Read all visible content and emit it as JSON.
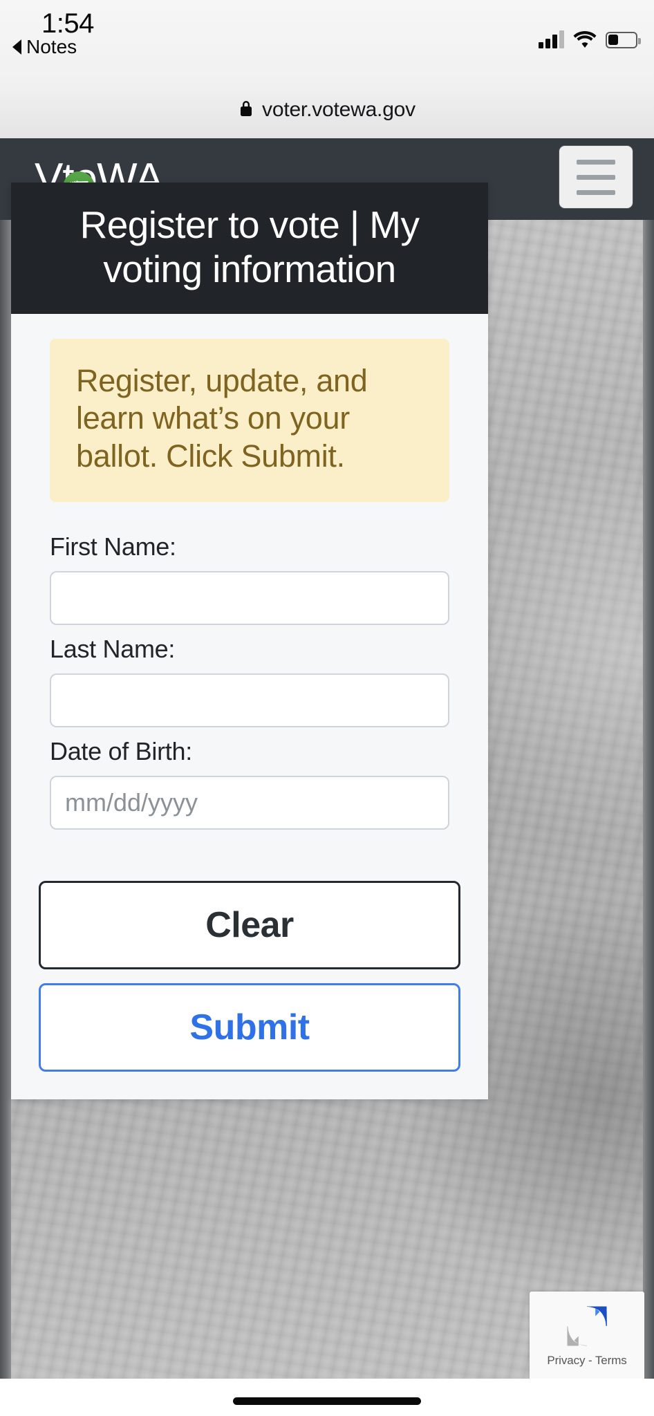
{
  "status_bar": {
    "time": "1:54",
    "back_label": "Notes",
    "icons": [
      "signal-icon",
      "wifi-icon",
      "battery-icon"
    ]
  },
  "browser": {
    "lock_icon": "lock-icon",
    "url": "voter.votewa.gov"
  },
  "site_header": {
    "logo_part1": "V",
    "logo_part2": "teWA",
    "logo_alt": "VoteWA",
    "menu_icon": "hamburger-menu-icon"
  },
  "card": {
    "title": "Register to vote | My voting information",
    "alert": {
      "text": "Register, update, and learn what’s on your ballot. Click Submit."
    },
    "fields": [
      {
        "label": "First Name:",
        "value": "",
        "placeholder": ""
      },
      {
        "label": "Last Name:",
        "value": "",
        "placeholder": ""
      },
      {
        "label": "Date of Birth:",
        "value": "",
        "placeholder": "mm/dd/yyyy"
      }
    ],
    "buttons": {
      "clear": "Clear",
      "submit": "Submit"
    }
  },
  "recaptcha": {
    "logo_icon": "recaptcha-icon",
    "links": "Privacy - Terms"
  },
  "colors": {
    "header_dark": "#343a40",
    "card_header": "#212529",
    "alert_bg": "#fbefc9",
    "alert_text": "#7e6420",
    "logo_green": "#56a546",
    "submit_blue": "#2f72e8",
    "clear_dark": "#2b3035"
  }
}
